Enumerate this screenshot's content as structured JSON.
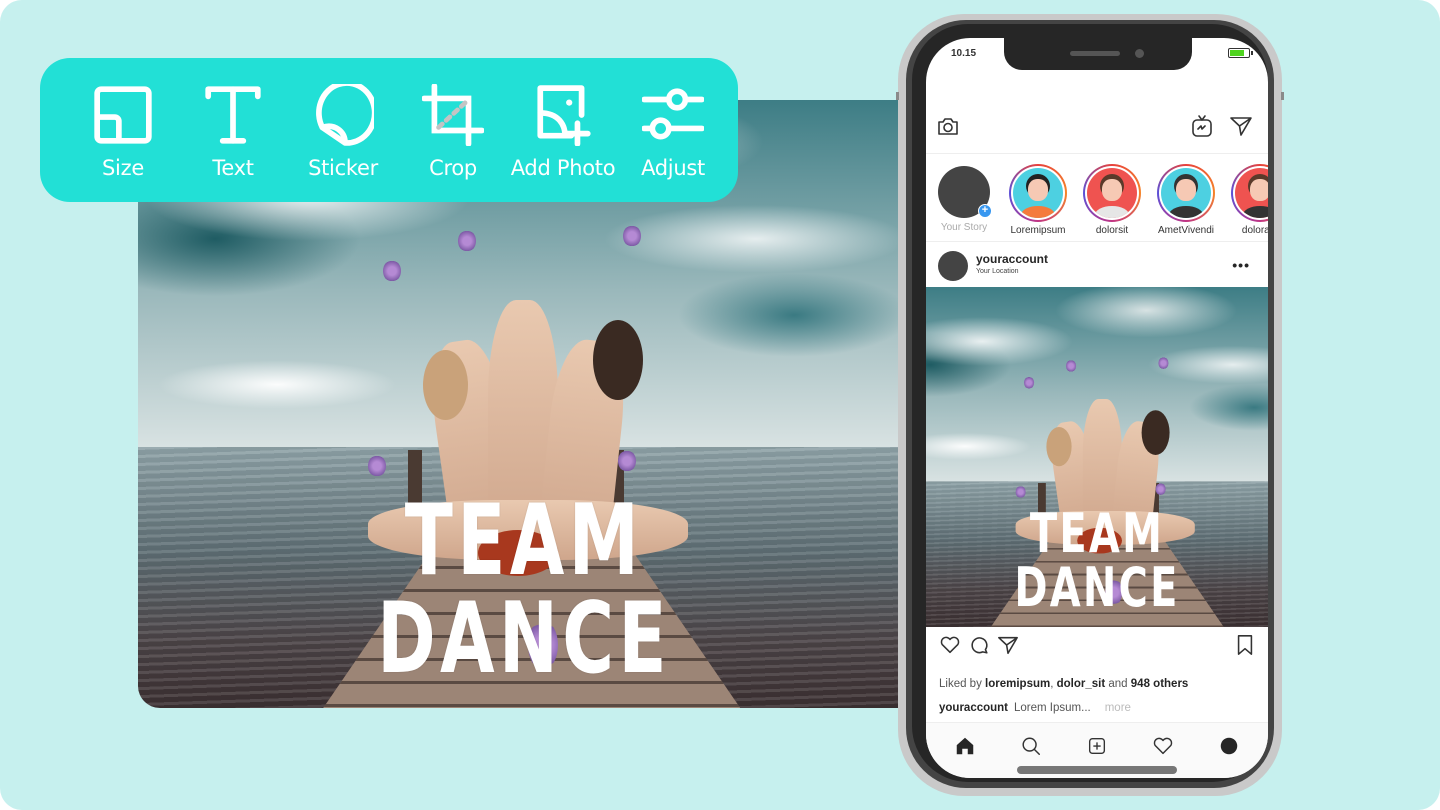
{
  "colors": {
    "background": "#c6f0ee",
    "toolbar": "#22e0d6",
    "phone_frame": "#c9c9c9",
    "story_plus": "#3897f0",
    "battery": "#4fd41f"
  },
  "toolbar": {
    "tools": [
      {
        "label": "Size",
        "icon": "size-icon"
      },
      {
        "label": "Text",
        "icon": "text-icon"
      },
      {
        "label": "Sticker",
        "icon": "sticker-icon"
      },
      {
        "label": "Crop",
        "icon": "crop-icon"
      },
      {
        "label": "Add Photo",
        "icon": "add-photo-icon"
      },
      {
        "label": "Adjust",
        "icon": "adjust-icon"
      }
    ]
  },
  "editor": {
    "photo_text": "TEAM DANCE"
  },
  "phone": {
    "status": {
      "time": "10.15",
      "battery_level": 0.8
    },
    "header": {
      "left_icon": "camera-icon",
      "right_icons": [
        "igtv-icon",
        "direct-message-icon"
      ]
    },
    "stories": [
      {
        "name": "Your Story",
        "own": true
      },
      {
        "name": "Loremipsum",
        "bg": "#4dd0e1",
        "shirt": "#f47b3c",
        "hair": "#222"
      },
      {
        "name": "dolorsit",
        "bg": "#ef5350",
        "shirt": "#e6e6e6",
        "hair": "#5a3a2a"
      },
      {
        "name": "AmetVivendi",
        "bg": "#4dd0e1",
        "shirt": "#333",
        "hair": "#333"
      },
      {
        "name": "doloram",
        "bg": "#ef5350",
        "shirt": "#333",
        "hair": "#5a3a2a"
      }
    ],
    "post": {
      "username": "youraccount",
      "location": "Your Location",
      "image_text": "TEAM DANCE",
      "liked_by_prefix": "Liked by",
      "liked_by_users": [
        "loremipsum",
        "dolor_sit"
      ],
      "liked_by_and": "and",
      "liked_by_others": "948 others",
      "caption_user": "youraccount",
      "caption_text": "Lorem Ipsum...",
      "more_label": "more"
    },
    "tabbar": [
      "home-icon",
      "search-icon",
      "new-post-icon",
      "activity-heart-icon",
      "profile-icon"
    ]
  }
}
